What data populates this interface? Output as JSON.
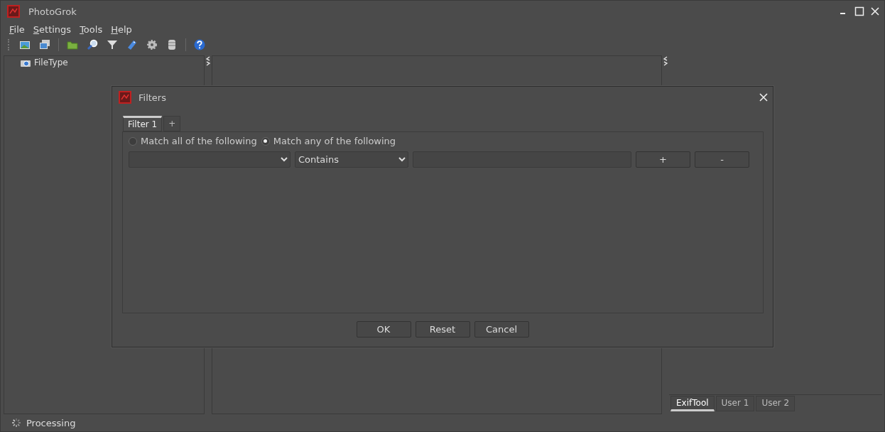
{
  "window": {
    "title": "PhotoGrok"
  },
  "menu": [
    "File",
    "Settings",
    "Tools",
    "Help"
  ],
  "tree": {
    "items": [
      {
        "label": "FileType"
      }
    ]
  },
  "dialog": {
    "title": "Filters",
    "tabs": [
      {
        "label": "Filter 1",
        "selected": true
      },
      {
        "label": "+",
        "selected": false
      }
    ],
    "match": [
      {
        "label": "Match all of the following",
        "selected": false
      },
      {
        "label": "Match any of the following",
        "selected": true
      }
    ],
    "rule": {
      "operator": "Contains",
      "add": "+",
      "remove": "-"
    },
    "buttons": [
      "OK",
      "Reset",
      "Cancel"
    ]
  },
  "right_tabs": [
    {
      "label": "ExifTool",
      "selected": true
    },
    {
      "label": "User 1",
      "selected": false
    },
    {
      "label": "User 2",
      "selected": false
    }
  ],
  "status_bar": {
    "text": "Processing"
  }
}
